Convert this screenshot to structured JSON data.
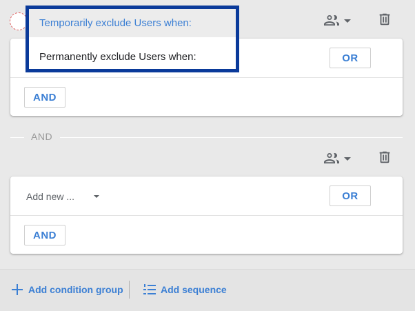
{
  "group1": {
    "or_label": "OR",
    "and_label": "AND"
  },
  "separator": {
    "label": "AND"
  },
  "group2": {
    "field_placeholder": "Add new ...",
    "or_label": "OR",
    "and_label": "AND"
  },
  "dropdown_menu": {
    "items": [
      {
        "label": "Temporarily exclude Users when:",
        "selected": true
      },
      {
        "label": "Permanently exclude Users when:",
        "selected": false
      }
    ]
  },
  "footer": {
    "add_condition_group": "Add condition group",
    "add_sequence": "Add sequence"
  },
  "colors": {
    "accent": "#3b7fd4",
    "menu_border": "#0a3a9a",
    "background": "#e9e9e9"
  },
  "icons": [
    "people-icon",
    "caret-down-icon",
    "trash-icon",
    "plus-icon",
    "list-numbered-icon"
  ]
}
